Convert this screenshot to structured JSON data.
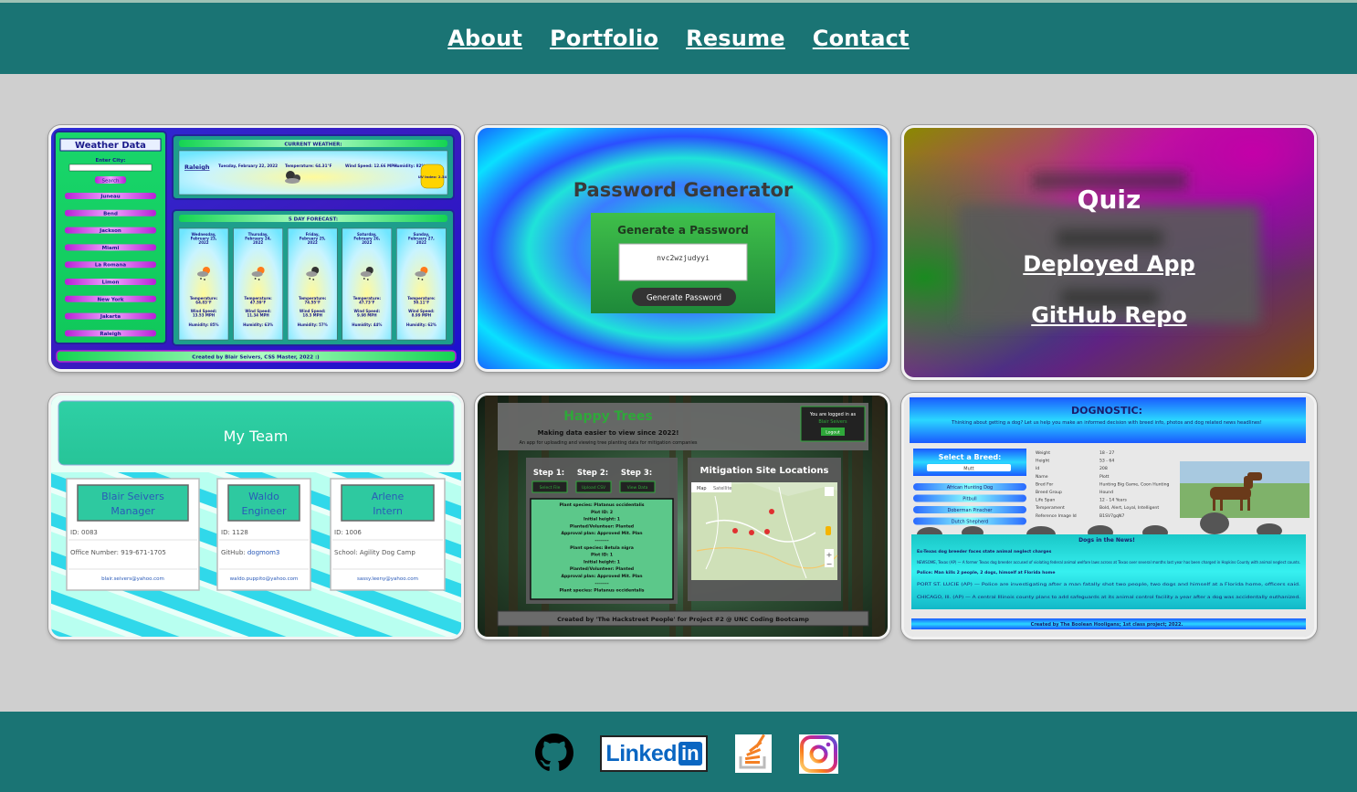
{
  "nav": {
    "links": [
      "About",
      "Portfolio",
      "Resume",
      "Contact"
    ]
  },
  "weather": {
    "title": "Weather Data",
    "enter_city": "Enter City:",
    "search": "Search",
    "cities": [
      "Juneau",
      "Bend",
      "Jackson",
      "Miami",
      "La Romana",
      "Limon",
      "New York",
      "Jakarta",
      "Raleigh"
    ],
    "current_header": "CURRENT WEATHER:",
    "current": {
      "city": "Raleigh",
      "date": "Tuesday, February 22, 2022",
      "temp": "Temperature: 64.31°F",
      "wind": "Wind Speed: 12.66 MPH",
      "humidity": "Humidity: 82%",
      "uv": "UV Index: 2.34"
    },
    "forecast_header": "5 DAY FORECAST:",
    "forecast": [
      {
        "date": "Wednesday, February 23, 2022",
        "temp": "Temperature: 64.83°F",
        "wind": "Wind Speed: 13.53 MPH",
        "hum": "Humidity: 85%"
      },
      {
        "date": "Thursday, February 24, 2022",
        "temp": "Temperature: 47.59°F",
        "wind": "Wind Speed: 11.34 MPH",
        "hum": "Humidity: 63%"
      },
      {
        "date": "Friday, February 25, 2022",
        "temp": "Temperature: 74.55°F",
        "wind": "Wind Speed: 18.3 MPH",
        "hum": "Humidity: 57%"
      },
      {
        "date": "Saturday, February 26, 2022",
        "temp": "Temperature: 47.73°F",
        "wind": "Wind Speed: 9.98 MPH",
        "hum": "Humidity: 44%"
      },
      {
        "date": "Sunday, February 27, 2022",
        "temp": "Temperature: 50.11°F",
        "wind": "Wind Speed: 8.99 MPH",
        "hum": "Humidity: 62%"
      }
    ],
    "footer": "Created by Blair Seivers, CSS Master, 2022 :)"
  },
  "password": {
    "title": "Password Generator",
    "subtitle": "Generate a Password",
    "value": "nvc2wzjudyyi",
    "button": "Generate Password"
  },
  "quiz": {
    "title": "Quiz",
    "deployed": "Deployed App",
    "repo": "GitHub Repo"
  },
  "team": {
    "title": "My Team",
    "members": [
      {
        "name": "Blair Seivers",
        "role": "Manager",
        "id": "ID: 0083",
        "info": "Office Number: 919-671-1705",
        "email": "blair.seivers@yahoo.com"
      },
      {
        "name": "Waldo",
        "role": "Engineer",
        "id": "ID: 1128",
        "info_label": "GitHub: ",
        "info_link": "dogmom3",
        "email": "waldo.puppito@yahoo.com"
      },
      {
        "name": "Arlene",
        "role": "Intern",
        "id": "ID: 1006",
        "info": "School: Agility Dog Camp",
        "email": "sassy.leeny@yahoo.com"
      }
    ]
  },
  "trees": {
    "title": "Happy Trees",
    "tagline": "Making data easier to view since 2022!",
    "desc": "An app for uploading and viewing tree planting data for mitigation companies",
    "login_line1": "You are logged in as",
    "login_user": "Blair Seivers",
    "logout": "Logout",
    "steps": [
      "Step 1:",
      "Step 2:",
      "Step 3:"
    ],
    "step_buttons": [
      "Select File",
      "Upload CSV",
      "View Data"
    ],
    "data_lines": [
      "Plant species: Platanus occidentalis",
      "Plot ID: 2",
      "Initial height: 1",
      "Planted/Volunteer: Planted",
      "Approval plan: Approved Mit. Plan",
      "--------",
      "Plant species: Betula nigra",
      "Plot ID: 1",
      "Initial height: 1",
      "Planted/Volunteer: Planted",
      "Approval plan: Approved Mit. Plan",
      "--------",
      "Plant species: Platanus occidentalis"
    ],
    "map_title": "Mitigation Site Locations",
    "map_tabs": [
      "Map",
      "Satellite"
    ],
    "footer": "Created by 'The Hackstreet People' for Project #2 @ UNC Coding Bootcamp"
  },
  "dog": {
    "title": "DOGNOSTIC:",
    "intro": "Thinking about getting a dog? Let us help you make an informed decision with breed info, photos and dog related news headlines!",
    "select_label": "Select a Breed:",
    "select_value": "Mutt",
    "breeds": [
      "African Hunting Dog",
      "Pitbull",
      "Doberman Pinscher",
      "Dutch Shepherd"
    ],
    "attributes": [
      [
        "Weight",
        "18 - 27"
      ],
      [
        "Height",
        "53 - 64"
      ],
      [
        "Id",
        "208"
      ],
      [
        "Name",
        "Plott"
      ],
      [
        "Bred For",
        "Hunting Big Game, Coon Hunting"
      ],
      [
        "Breed Group",
        "Hound"
      ],
      [
        "Life Span",
        "12 - 14 Years"
      ],
      [
        "Temperament",
        "Bold, Alert, Loyal, Intelligent"
      ],
      [
        "Reference Image Id",
        "B1SV7gqN7"
      ]
    ],
    "news_title": "Dogs in the News!",
    "news": [
      "Ex-Texas dog breeder faces state animal neglect charges",
      "NEWSOME, Texas (AP) — A former Texas dog breeder accused of violating federal animal welfare laws across at Texas over several months last year has been charged in Hopkins County with animal neglect counts.",
      "Police: Man kills 2 people, 2 dogs, himself at Florida home",
      "PORT ST. LUCIE (AP) — Police are investigating after a man fatally shot two people, two dogs and himself at a Florida home, officers said.",
      "CHICAGO, Ill. (AP) — A central Illinois county plans to add safeguards at its animal control facility a year after a dog was accidentally euthanized."
    ],
    "footer": "Created by The Boolean Hooligans; 1st class project; 2022."
  },
  "social": {
    "linkedin_text": "Linked",
    "linkedin_in": "in"
  }
}
